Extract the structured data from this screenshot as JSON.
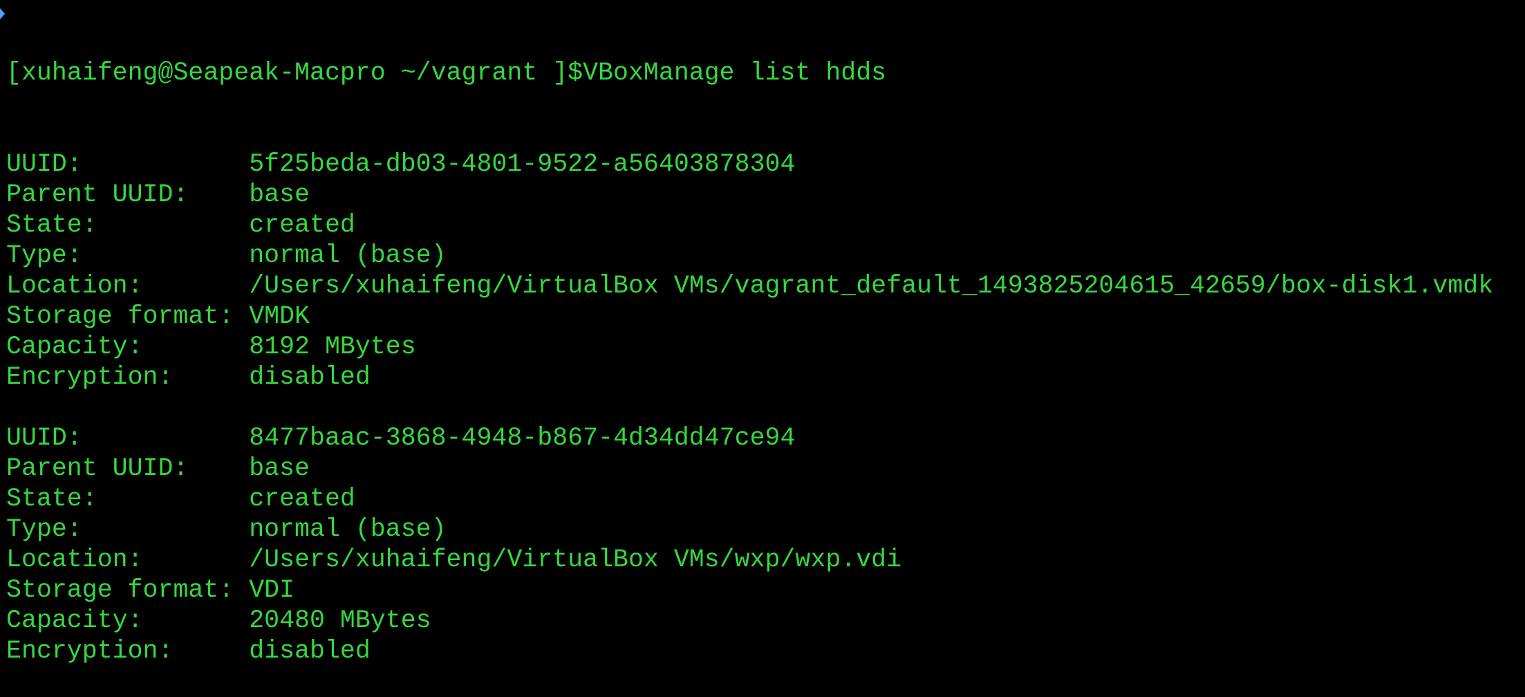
{
  "colors": {
    "foreground": "#35d83f",
    "background": "#000000",
    "prompt_marker": "#4aa3ff"
  },
  "prompt": {
    "icon": "prompt-marker-icon",
    "text": "[xuhaifeng@Seapeak-Macpro ~/vagrant ]$",
    "command": "VBoxManage list hdds"
  },
  "disks": [
    {
      "fields": [
        {
          "label": "UUID:",
          "value": "5f25beda-db03-4801-9522-a56403878304"
        },
        {
          "label": "Parent UUID:",
          "value": "base"
        },
        {
          "label": "State:",
          "value": "created"
        },
        {
          "label": "Type:",
          "value": "normal (base)"
        },
        {
          "label": "Location:",
          "value": "/Users/xuhaifeng/VirtualBox VMs/vagrant_default_1493825204615_42659/box-disk1.vmdk"
        },
        {
          "label": "Storage format:",
          "value": "VMDK"
        },
        {
          "label": "Capacity:",
          "value": "8192 MBytes"
        },
        {
          "label": "Encryption:",
          "value": "disabled"
        }
      ]
    },
    {
      "fields": [
        {
          "label": "UUID:",
          "value": "8477baac-3868-4948-b867-4d34dd47ce94"
        },
        {
          "label": "Parent UUID:",
          "value": "base"
        },
        {
          "label": "State:",
          "value": "created"
        },
        {
          "label": "Type:",
          "value": "normal (base)"
        },
        {
          "label": "Location:",
          "value": "/Users/xuhaifeng/VirtualBox VMs/wxp/wxp.vdi"
        },
        {
          "label": "Storage format:",
          "value": "VDI"
        },
        {
          "label": "Capacity:",
          "value": "20480 MBytes"
        },
        {
          "label": "Encryption:",
          "value": "disabled"
        }
      ]
    }
  ]
}
